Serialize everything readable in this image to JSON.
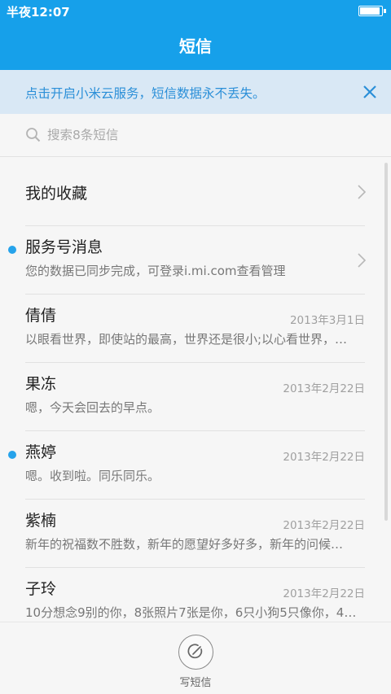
{
  "status": {
    "time": "半夜12:07",
    "battery_level": 0.95
  },
  "header": {
    "title": "短信"
  },
  "banner": {
    "text": "点击开启小米云服务，短信数据永不丢失。"
  },
  "search": {
    "placeholder": "搜索8条短信"
  },
  "messages": [
    {
      "name": "我的收藏",
      "preview": "",
      "date": "",
      "unread": false,
      "chevron": true
    },
    {
      "name": "服务号消息",
      "preview": "您的数据已同步完成，可登录i.mi.com查看管理",
      "date": "",
      "unread": true,
      "chevron": true
    },
    {
      "name": "倩倩",
      "preview": "以眼看世界，即使站的最高，世界还是很小;以心看世界，…",
      "date": "2013年3月1日",
      "unread": false,
      "chevron": false
    },
    {
      "name": "果冻",
      "preview": "嗯，今天会回去的早点。",
      "date": "2013年2月22日",
      "unread": false,
      "chevron": false
    },
    {
      "name": "燕婷",
      "preview": "嗯。收到啦。同乐同乐。",
      "date": "2013年2月22日",
      "unread": true,
      "chevron": false
    },
    {
      "name": "紫楠",
      "preview": "新年的祝福数不胜数，新年的愿望好多好多，新年的问候…",
      "date": "2013年2月22日",
      "unread": false,
      "chevron": false
    },
    {
      "name": "子玲",
      "preview": "10分想念9别的你，8张照片7张是你，6只小狗5只像你，4…",
      "date": "2013年2月22日",
      "unread": false,
      "chevron": false
    }
  ],
  "bottom": {
    "compose_label": "写短信"
  },
  "colors": {
    "accent": "#16a0ea",
    "unread_dot": "#26a3eb",
    "banner_bg": "#d9e8f5",
    "banner_text": "#2b8fd8"
  }
}
